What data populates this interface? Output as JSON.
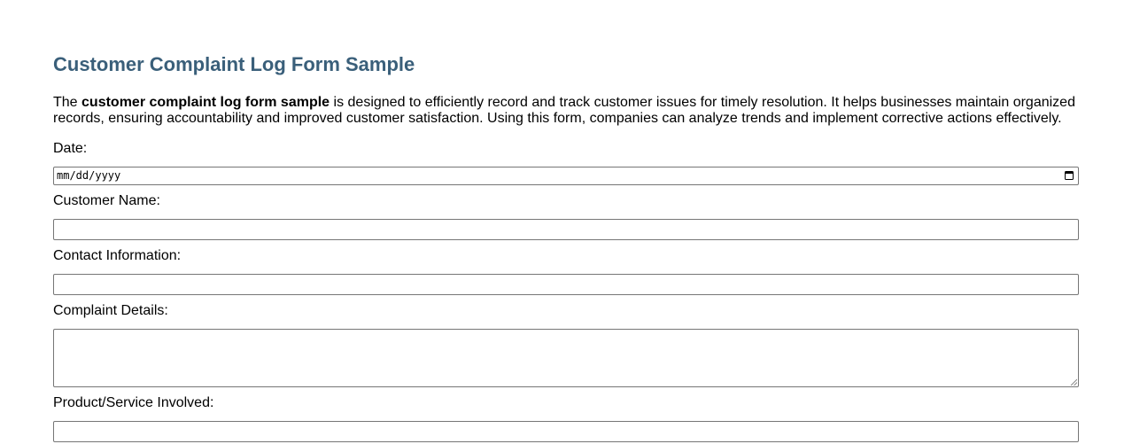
{
  "page": {
    "title": "Customer Complaint Log Form Sample",
    "intro_prefix": "The ",
    "intro_bold": "customer complaint log form sample",
    "intro_suffix": " is designed to efficiently record and track customer issues for timely resolution. It helps businesses maintain organized records, ensuring accountability and improved customer satisfaction. Using this form, companies can analyze trends and implement corrective actions effectively."
  },
  "form": {
    "date": {
      "label": "Date:",
      "placeholder": "mm/dd/yyyy",
      "icon": "calendar-icon"
    },
    "customer_name": {
      "label": "Customer Name:",
      "value": ""
    },
    "contact_info": {
      "label": "Contact Information:",
      "value": ""
    },
    "complaint_details": {
      "label": "Complaint Details:",
      "value": ""
    },
    "product_service": {
      "label": "Product/Service Involved:",
      "value": ""
    }
  },
  "colors": {
    "title": "#3a5f7a",
    "text": "#000000",
    "border": "#767676"
  }
}
